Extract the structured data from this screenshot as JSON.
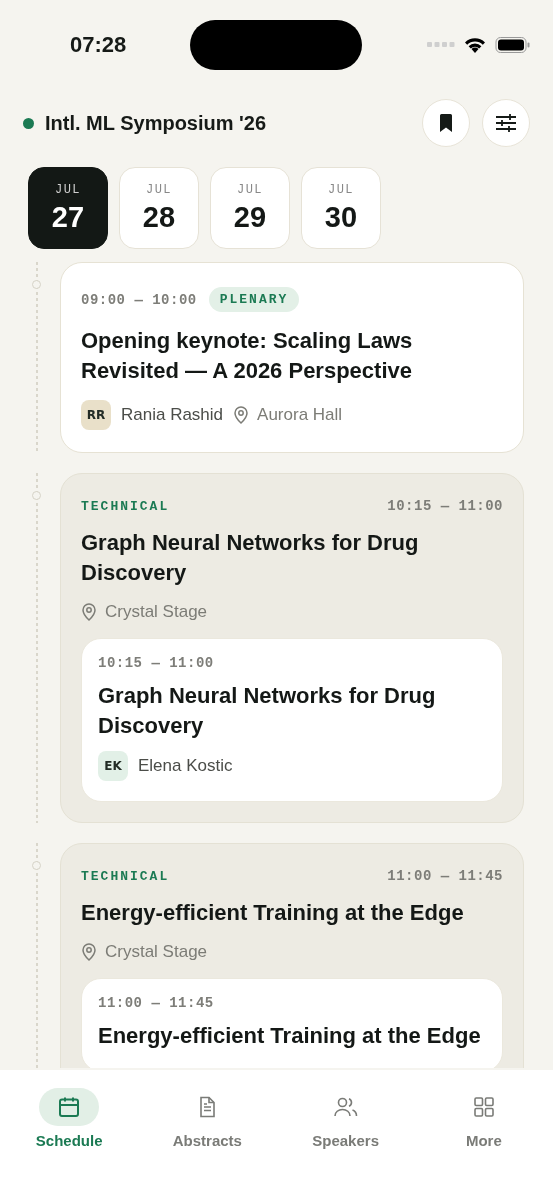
{
  "status_bar": {
    "time": "07:28"
  },
  "header": {
    "title": "Intl. ML Symposium '26",
    "live": true
  },
  "dates": [
    {
      "month": "JUL",
      "day": "27",
      "selected": true
    },
    {
      "month": "JUL",
      "day": "28",
      "selected": false
    },
    {
      "month": "JUL",
      "day": "29",
      "selected": false
    },
    {
      "month": "JUL",
      "day": "30",
      "selected": false
    }
  ],
  "sessions": [
    {
      "kind": "single",
      "time": "09:00 — 10:00",
      "tag": "PLENARY",
      "title": "Opening keynote: Scaling Laws Revisited — A 2026 Perspective",
      "speaker": {
        "initials": "RR",
        "name": "Rania Rashid",
        "color": "#e9e0c9"
      },
      "room": "Aurora Hall"
    },
    {
      "kind": "track",
      "tag": "TECHNICAL",
      "time": "10:15 — 11:00",
      "title": "Graph Neural Networks for Drug Discovery",
      "room": "Crystal Stage",
      "talks": [
        {
          "time": "10:15 — 11:00",
          "title": "Graph Neural Networks for Drug Discovery",
          "speaker": {
            "initials": "EK",
            "name": "Elena Kostic",
            "color": "#e2f0e7"
          }
        }
      ]
    },
    {
      "kind": "track",
      "tag": "TECHNICAL",
      "time": "11:00 — 11:45",
      "title": "Energy-efficient Training at the Edge",
      "room": "Crystal Stage",
      "talks": [
        {
          "time": "11:00 — 11:45",
          "title": "Energy-efficient Training at the Edge"
        }
      ]
    }
  ],
  "nav": [
    {
      "kind": "calendar",
      "label": "Schedule",
      "selected": true
    },
    {
      "kind": "document",
      "label": "Abstracts",
      "selected": false
    },
    {
      "kind": "people",
      "label": "Speakers",
      "selected": false
    },
    {
      "kind": "grid",
      "label": "More",
      "selected": false
    }
  ]
}
